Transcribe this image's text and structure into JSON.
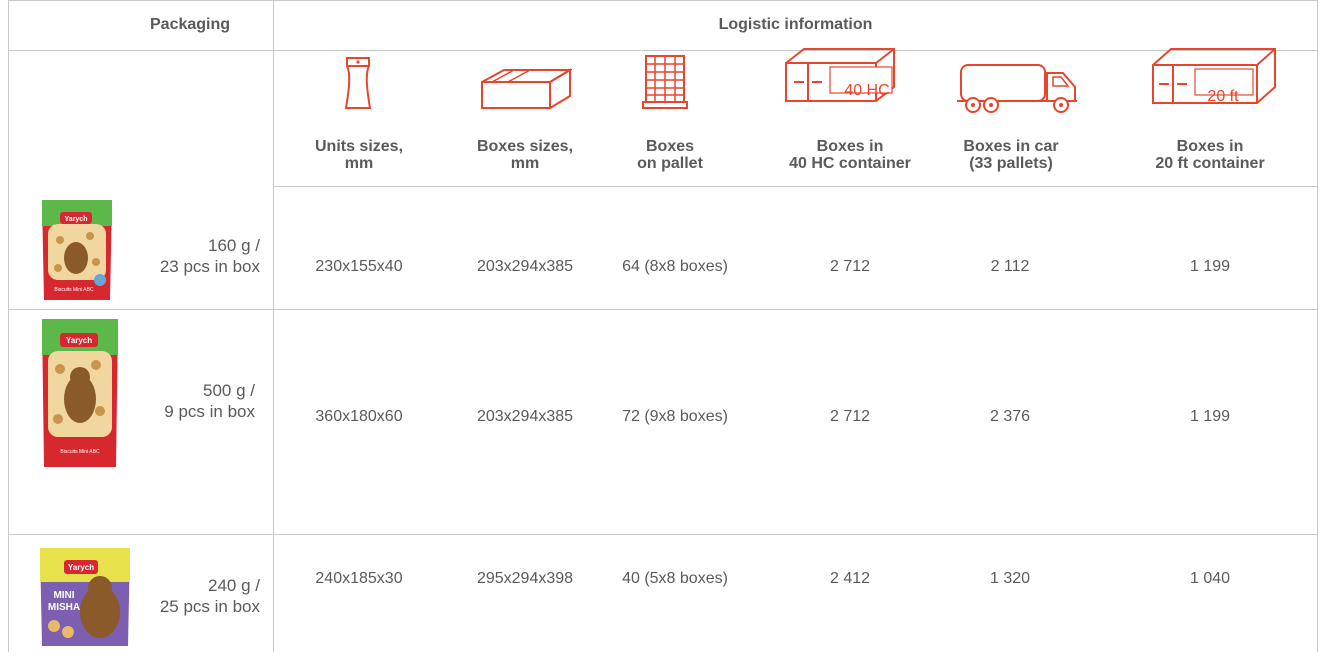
{
  "header": {
    "packaging": "Packaging",
    "logistic": "Logistic information"
  },
  "columns": [
    {
      "label": "Units sizes,\nmm",
      "icon": "pouch-icon"
    },
    {
      "label": "Boxes sizes,\nmm",
      "icon": "box-icon"
    },
    {
      "label": "Boxes\non pallet",
      "icon": "pallet-icon"
    },
    {
      "label": "Boxes in\n40 HC container",
      "icon": "container-40hc-icon",
      "icon_text": "40 HC"
    },
    {
      "label": "Boxes in car\n(33 pallets)",
      "icon": "truck-icon"
    },
    {
      "label": "Boxes in\n20 ft container",
      "icon": "container-20ft-icon",
      "icon_text": "20 ft"
    }
  ],
  "rows": [
    {
      "packaging": "160 g /\n23 pcs in box",
      "product": {
        "brand": "Yarych",
        "caption": "Biscuits Mini ABC",
        "colors": {
          "top": "#5db84a",
          "bottom": "#d7272f"
        }
      },
      "cells": [
        "230x155x40",
        "203x294x385",
        "64 (8x8 boxes)",
        "2 712",
        "2 112",
        "1 199"
      ]
    },
    {
      "packaging": "500 g /\n9 pcs in box",
      "product": {
        "brand": "Yarych",
        "caption": "Biscuits Mini ABC",
        "colors": {
          "top": "#5db84a",
          "bottom": "#d7272f"
        }
      },
      "cells": [
        "360x180x60",
        "203x294x385",
        "72 (9x8 boxes)",
        "2 712",
        "2 376",
        "1 199"
      ]
    },
    {
      "packaging": "240 g /\n25 pcs in box",
      "product": {
        "brand": "Yarych",
        "caption": "MINI MISHA",
        "colors": {
          "top": "#e7e24c",
          "bottom": "#7c5fb0"
        }
      },
      "cells": [
        "240x185x30",
        "295x294x398",
        "40 (5x8 boxes)",
        "2 412",
        "1 320",
        "1 040"
      ]
    }
  ],
  "colors": {
    "accent": "#e8452d",
    "text": "#5a5a5a",
    "rule": "#c9c9c9"
  }
}
